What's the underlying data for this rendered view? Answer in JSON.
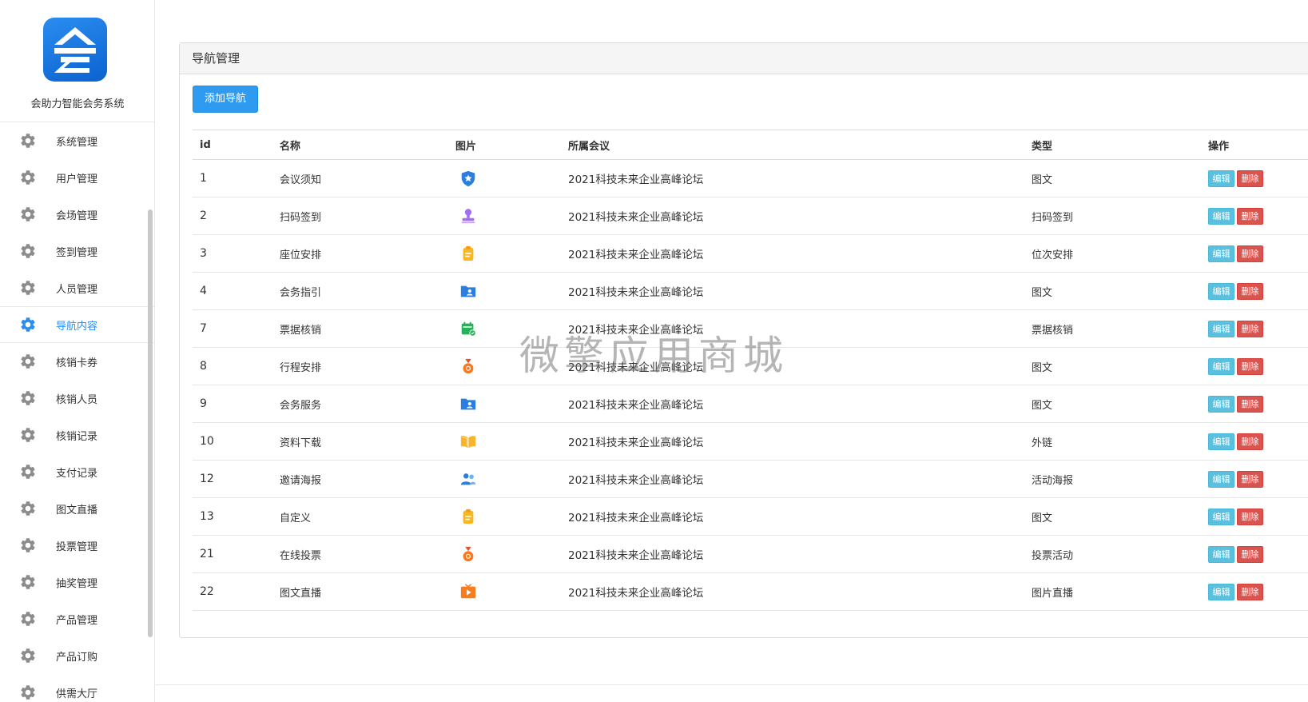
{
  "app": {
    "name": "会助力智能会务系统"
  },
  "sidebar": {
    "items": [
      {
        "label": "系统管理",
        "active": false
      },
      {
        "label": "用户管理",
        "active": false
      },
      {
        "label": "会场管理",
        "active": false
      },
      {
        "label": "签到管理",
        "active": false
      },
      {
        "label": "人员管理",
        "active": false
      },
      {
        "label": "导航内容",
        "active": true
      },
      {
        "label": "核销卡券",
        "active": false
      },
      {
        "label": "核销人员",
        "active": false
      },
      {
        "label": "核销记录",
        "active": false
      },
      {
        "label": "支付记录",
        "active": false
      },
      {
        "label": "图文直播",
        "active": false
      },
      {
        "label": "投票管理",
        "active": false
      },
      {
        "label": "抽奖管理",
        "active": false
      },
      {
        "label": "产品管理",
        "active": false
      },
      {
        "label": "产品订购",
        "active": false
      },
      {
        "label": "供需大厅",
        "active": false
      }
    ]
  },
  "panel": {
    "title": "导航管理",
    "add_button": "添加导航"
  },
  "table": {
    "headers": {
      "id": "id",
      "name": "名称",
      "image": "图片",
      "conference": "所属会议",
      "type": "类型",
      "action": "操作"
    },
    "edit_label": "编辑",
    "delete_label": "删除",
    "rows": [
      {
        "id": "1",
        "name": "会议须知",
        "icon": "shield-star-icon",
        "conference": "2021科技未来企业高峰论坛",
        "type": "图文"
      },
      {
        "id": "2",
        "name": "扫码签到",
        "icon": "stamp-icon",
        "conference": "2021科技未来企业高峰论坛",
        "type": "扫码签到"
      },
      {
        "id": "3",
        "name": "座位安排",
        "icon": "clipboard-icon",
        "conference": "2021科技未来企业高峰论坛",
        "type": "位次安排"
      },
      {
        "id": "4",
        "name": "会务指引",
        "icon": "folder-user-icon",
        "conference": "2021科技未来企业高峰论坛",
        "type": "图文"
      },
      {
        "id": "7",
        "name": "票据核销",
        "icon": "calendar-check-icon",
        "conference": "2021科技未来企业高峰论坛",
        "type": "票据核销"
      },
      {
        "id": "8",
        "name": "行程安排",
        "icon": "medal-icon",
        "conference": "2021科技未来企业高峰论坛",
        "type": "图文"
      },
      {
        "id": "9",
        "name": "会务服务",
        "icon": "folder-user-icon",
        "conference": "2021科技未来企业高峰论坛",
        "type": "图文"
      },
      {
        "id": "10",
        "name": "资料下载",
        "icon": "book-icon",
        "conference": "2021科技未来企业高峰论坛",
        "type": "外链"
      },
      {
        "id": "12",
        "name": "邀请海报",
        "icon": "users-icon",
        "conference": "2021科技未来企业高峰论坛",
        "type": "活动海报"
      },
      {
        "id": "13",
        "name": "自定义",
        "icon": "clipboard-icon",
        "conference": "2021科技未来企业高峰论坛",
        "type": "图文"
      },
      {
        "id": "21",
        "name": "在线投票",
        "icon": "medal-icon",
        "conference": "2021科技未来企业高峰论坛",
        "type": "投票活动"
      },
      {
        "id": "22",
        "name": "图文直播",
        "icon": "tv-play-icon",
        "conference": "2021科技未来企业高峰论坛",
        "type": "图片直播"
      }
    ]
  },
  "watermark": "微擎应用商城",
  "colors": {
    "primary": "#2e9bf0",
    "edit": "#5bc0de",
    "delete": "#d9534f",
    "active_menu": "#2a8df0"
  }
}
